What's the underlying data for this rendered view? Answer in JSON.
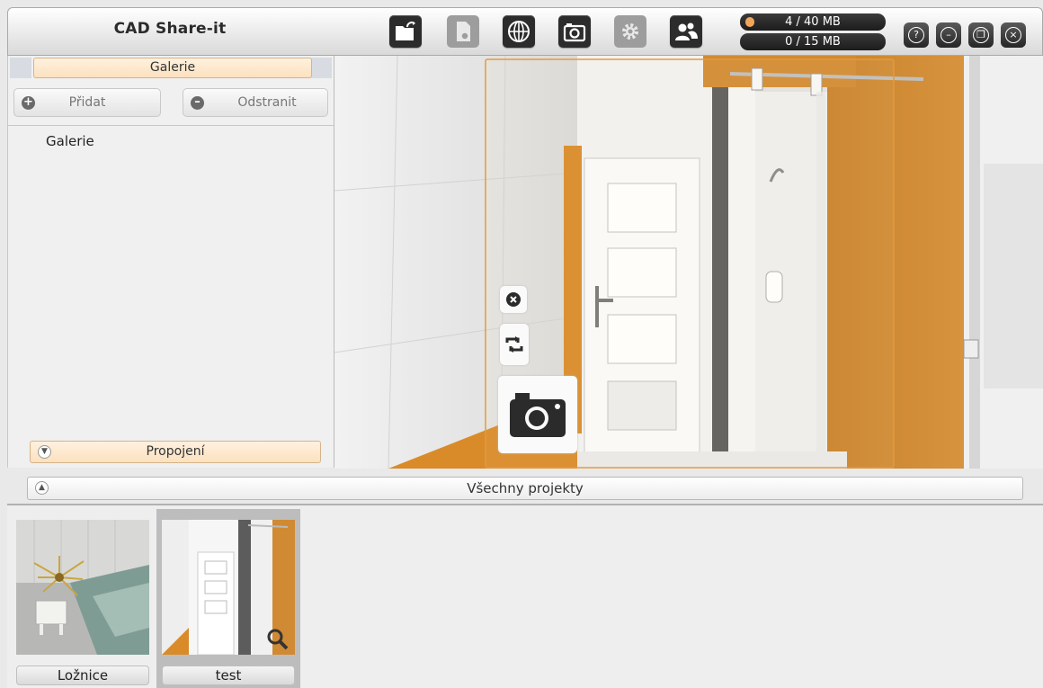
{
  "app": {
    "title": "CAD Share-it"
  },
  "toolbar": {
    "tools": [
      {
        "name": "open-folder-icon",
        "enabled": true
      },
      {
        "name": "document-icon",
        "enabled": false
      },
      {
        "name": "globe-icon",
        "enabled": true
      },
      {
        "name": "camera-icon",
        "enabled": true
      },
      {
        "name": "gear-icon",
        "enabled": false
      },
      {
        "name": "users-icon",
        "enabled": true
      }
    ],
    "storage_primary": "4 / 40 MB",
    "storage_secondary": "0 / 15 MB",
    "window_controls": {
      "help": "?",
      "minimize": "–",
      "restore": "❐",
      "close": "×"
    }
  },
  "gallery_panel": {
    "tab_label": "Galerie",
    "add_label": "Přidat",
    "remove_label": "Odstranit",
    "tree_items": [
      "Galerie"
    ],
    "connections_label": "Propojení"
  },
  "projects": {
    "header_label": "Všechny projekty",
    "items": [
      {
        "label": "Ložnice",
        "selected": false
      },
      {
        "label": "test",
        "selected": true
      }
    ]
  },
  "colors": {
    "accent_orange": "#e39a3c",
    "wall_orange": "#d98b2a",
    "toolbar_dark": "#2c2c2c",
    "tab_highlight": "#fbe1bf"
  }
}
